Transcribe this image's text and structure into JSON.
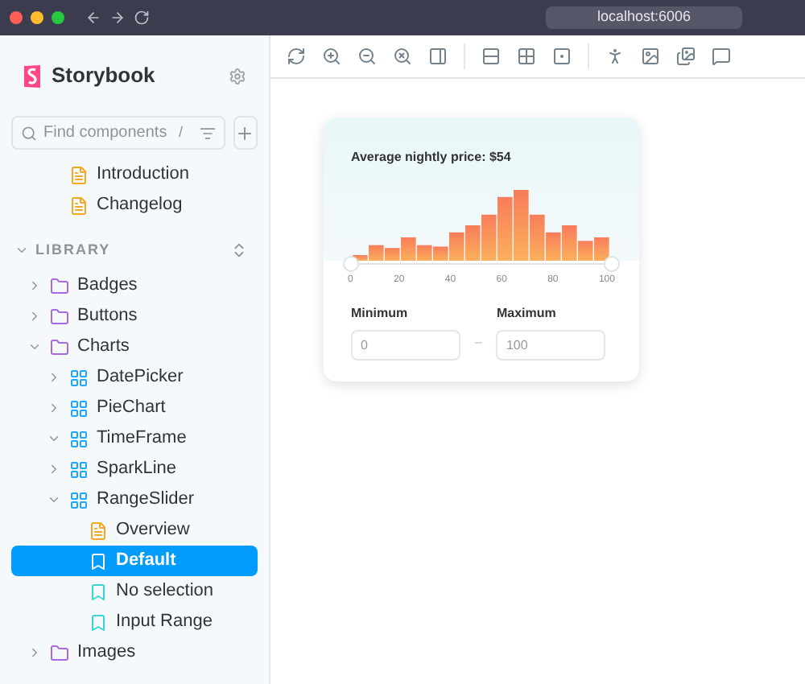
{
  "browser": {
    "address": "localhost:6006"
  },
  "sidebar": {
    "title": "Storybook",
    "search": {
      "placeholder": "Find components",
      "shortcut": "/"
    },
    "top_items": [
      {
        "label": "Introduction",
        "kind": "doc",
        "selected": false
      },
      {
        "label": "Changelog",
        "kind": "doc",
        "selected": false
      }
    ],
    "section": {
      "label": "LIBRARY",
      "expanded": true
    },
    "tree": [
      {
        "label": "Badges",
        "kind": "folder",
        "expanded": false,
        "selected": false
      },
      {
        "label": "Buttons",
        "kind": "folder",
        "expanded": false,
        "selected": false
      },
      {
        "label": "Charts",
        "kind": "folder",
        "expanded": true,
        "selected": false,
        "children": [
          {
            "label": "DatePicker",
            "kind": "component",
            "expanded": false,
            "selected": false
          },
          {
            "label": "PieChart",
            "kind": "component",
            "expanded": false,
            "selected": false
          },
          {
            "label": "TimeFrame",
            "kind": "component",
            "expanded": true,
            "selected": false
          },
          {
            "label": "SparkLine",
            "kind": "component",
            "expanded": false,
            "selected": false
          },
          {
            "label": "RangeSlider",
            "kind": "component",
            "expanded": true,
            "selected": false,
            "children": [
              {
                "label": "Overview",
                "kind": "doc",
                "selected": false
              },
              {
                "label": "Default",
                "kind": "story",
                "selected": true
              },
              {
                "label": "No selection",
                "kind": "story",
                "selected": false
              },
              {
                "label": "Input Range",
                "kind": "story",
                "selected": false
              }
            ]
          }
        ]
      },
      {
        "label": "Images",
        "kind": "folder",
        "expanded": false,
        "selected": false
      }
    ]
  },
  "card": {
    "title": "Average nightly price: $54",
    "range": {
      "thumbs": [
        {
          "level": 0
        },
        {
          "level": 1
        }
      ]
    },
    "ticks": [
      "0",
      "20",
      "40",
      "60",
      "80",
      "100"
    ],
    "minimum": {
      "label": "Minimum",
      "value": "0"
    },
    "separator": "–",
    "maximum": {
      "label": "Maximum",
      "value": "100"
    }
  }
}
